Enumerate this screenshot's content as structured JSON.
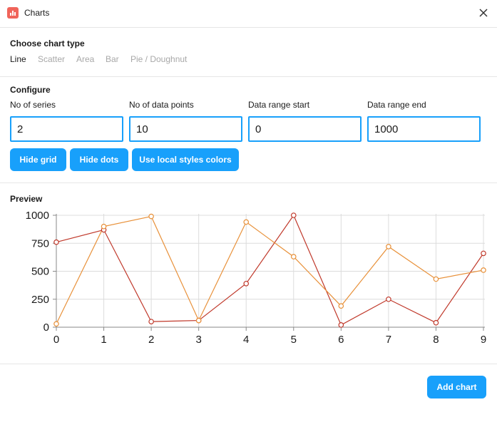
{
  "window": {
    "title": "Charts",
    "icon": "bar-chart-icon",
    "icon_color": "#f0645a"
  },
  "chart_type": {
    "heading": "Choose chart type",
    "options": [
      "Line",
      "Scatter",
      "Area",
      "Bar",
      "Pie / Doughnut"
    ],
    "selected": "Line"
  },
  "configure": {
    "heading": "Configure",
    "fields": [
      {
        "label": "No of series",
        "value": "2"
      },
      {
        "label": "No of data points",
        "value": "10"
      },
      {
        "label": "Data range start",
        "value": "0"
      },
      {
        "label": "Data range end",
        "value": "1000"
      }
    ],
    "buttons": [
      "Hide grid",
      "Hide dots",
      "Use local styles colors"
    ]
  },
  "preview": {
    "heading": "Preview"
  },
  "footer": {
    "add_label": "Add chart"
  },
  "colors": {
    "accent": "#18a0fb",
    "series1": "#c0392b",
    "series2": "#e8913a",
    "grid": "#dcdcdc"
  },
  "chart_data": {
    "type": "line",
    "title": "",
    "xlabel": "",
    "ylabel": "",
    "x": [
      0,
      1,
      2,
      3,
      4,
      5,
      6,
      7,
      8,
      9
    ],
    "xlim": [
      0,
      9
    ],
    "ylim": [
      0,
      1000
    ],
    "yticks": [
      0,
      250,
      500,
      750,
      1000
    ],
    "grid": true,
    "markers": true,
    "series": [
      {
        "values": [
          760,
          870,
          50,
          60,
          390,
          1000,
          20,
          250,
          40,
          660
        ],
        "color": "#c0392b"
      },
      {
        "values": [
          30,
          900,
          990,
          60,
          940,
          630,
          190,
          720,
          430,
          510
        ],
        "color": "#e8913a"
      }
    ]
  }
}
